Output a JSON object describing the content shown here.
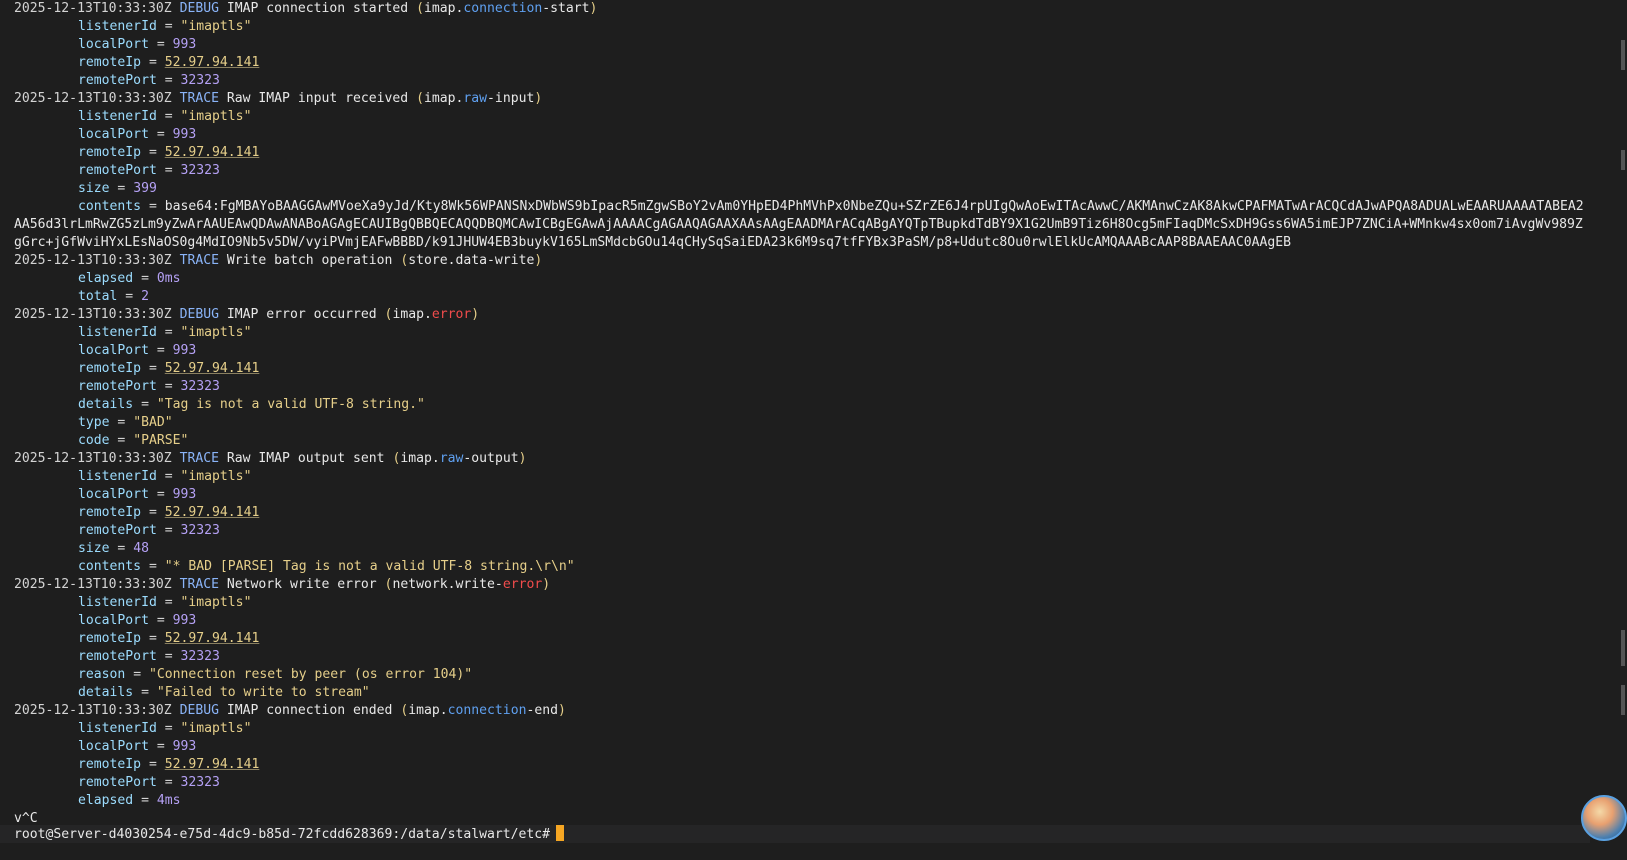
{
  "terminal": {
    "lines": [
      {
        "type": "header",
        "ts": "2025-12-13T10:33:30Z",
        "level": "DEBUG",
        "msg": "IMAP connection started",
        "event": [
          "imap.",
          "connection",
          "-start"
        ],
        "ev_error": false
      },
      {
        "type": "kv",
        "key": "listenerId",
        "val": "\"imaptls\"",
        "vtype": "str"
      },
      {
        "type": "kv",
        "key": "localPort",
        "val": "993",
        "vtype": "num"
      },
      {
        "type": "kv",
        "key": "remoteIp",
        "val": "52.97.94.141",
        "vtype": "ip"
      },
      {
        "type": "kv",
        "key": "remotePort",
        "val": "32323",
        "vtype": "num"
      },
      {
        "type": "header",
        "ts": "2025-12-13T10:33:30Z",
        "level": "TRACE",
        "msg": "Raw IMAP input received",
        "event": [
          "imap.",
          "raw",
          "-input"
        ],
        "ev_error": false
      },
      {
        "type": "kv",
        "key": "listenerId",
        "val": "\"imaptls\"",
        "vtype": "str"
      },
      {
        "type": "kv",
        "key": "localPort",
        "val": "993",
        "vtype": "num"
      },
      {
        "type": "kv",
        "key": "remoteIp",
        "val": "52.97.94.141",
        "vtype": "ip"
      },
      {
        "type": "kv",
        "key": "remotePort",
        "val": "32323",
        "vtype": "num"
      },
      {
        "type": "kv",
        "key": "size",
        "val": "399",
        "vtype": "num"
      },
      {
        "type": "kv",
        "key": "contents",
        "val": "base64:FgMBAYoBAAGGAwMVoeXa9yJd/Kty8Wk56WPANSNxDWbWS9bIpacR5mZgwSBoY2vAm0YHpED4PhMVhPx0NbeZQu+SZrZE6J4rpUIgQwAoEwITAcAwwC/AKMAnwCzAK8AkwCPAFMATwArACQCdAJwAPQA8ADUALwEAARUAAAATABEA2",
        "vtype": "b64"
      },
      {
        "type": "raw",
        "text": "AA56d3lrLmRwZG5zLm9yZwArAAUEAwQDAwANABoAGAgECAUIBgQBBQECAQQDBQMCAwICBgEGAwAjAAAACgAGAAQAGAAXAAsAAgEAADMArACqABgAYQTpTBupkdTdBY9X1G2UmB9Tiz6H8Ocg5mFIaqDMcSxDH9Gss6WA5imEJP7ZNCiA+WMnkw4sx0om7iAvgWv989Z"
      },
      {
        "type": "raw",
        "text": "gGrc+jGfWviHYxLEsNaOS0g4MdIO9Nb5v5DW/vyiPVmjEAFwBBBD/k91JHUW4EB3buykV165LmSMdcbGOu14qCHySqSaiEDA23k6M9sq7tfFYBx3PaSM/p8+Udutc8Ou0rwlElkUcAMQAAABcAAP8BAAEAAC0AAgEB"
      },
      {
        "type": "header",
        "ts": "2025-12-13T10:33:30Z",
        "level": "TRACE",
        "msg": "Write batch operation",
        "event": [
          "store.data-write",
          "",
          ""
        ],
        "ev_error": false
      },
      {
        "type": "kv",
        "key": "elapsed",
        "val": "0ms",
        "vtype": "num"
      },
      {
        "type": "kv",
        "key": "total",
        "val": "2",
        "vtype": "num"
      },
      {
        "type": "header",
        "ts": "2025-12-13T10:33:30Z",
        "level": "DEBUG",
        "msg": "IMAP error occurred",
        "event": [
          "imap.",
          "error",
          ""
        ],
        "ev_error": true
      },
      {
        "type": "kv",
        "key": "listenerId",
        "val": "\"imaptls\"",
        "vtype": "str"
      },
      {
        "type": "kv",
        "key": "localPort",
        "val": "993",
        "vtype": "num"
      },
      {
        "type": "kv",
        "key": "remoteIp",
        "val": "52.97.94.141",
        "vtype": "ip"
      },
      {
        "type": "kv",
        "key": "remotePort",
        "val": "32323",
        "vtype": "num"
      },
      {
        "type": "kv",
        "key": "details",
        "val": "\"Tag is not a valid UTF-8 string.\"",
        "vtype": "str"
      },
      {
        "type": "kv",
        "key": "type",
        "val": "\"BAD\"",
        "vtype": "str"
      },
      {
        "type": "kv",
        "key": "code",
        "val": "\"PARSE\"",
        "vtype": "str"
      },
      {
        "type": "header",
        "ts": "2025-12-13T10:33:30Z",
        "level": "TRACE",
        "msg": "Raw IMAP output sent",
        "event": [
          "imap.",
          "raw",
          "-output"
        ],
        "ev_error": false
      },
      {
        "type": "kv",
        "key": "listenerId",
        "val": "\"imaptls\"",
        "vtype": "str"
      },
      {
        "type": "kv",
        "key": "localPort",
        "val": "993",
        "vtype": "num"
      },
      {
        "type": "kv",
        "key": "remoteIp",
        "val": "52.97.94.141",
        "vtype": "ip"
      },
      {
        "type": "kv",
        "key": "remotePort",
        "val": "32323",
        "vtype": "num"
      },
      {
        "type": "kv",
        "key": "size",
        "val": "48",
        "vtype": "num"
      },
      {
        "type": "kv",
        "key": "contents",
        "val": "\"* BAD [PARSE] Tag is not a valid UTF-8 string.\\r\\n\"",
        "vtype": "str"
      },
      {
        "type": "header",
        "ts": "2025-12-13T10:33:30Z",
        "level": "TRACE",
        "msg": "Network write error",
        "event": [
          "network.write-",
          "error",
          ""
        ],
        "ev_error": true
      },
      {
        "type": "kv",
        "key": "listenerId",
        "val": "\"imaptls\"",
        "vtype": "str"
      },
      {
        "type": "kv",
        "key": "localPort",
        "val": "993",
        "vtype": "num"
      },
      {
        "type": "kv",
        "key": "remoteIp",
        "val": "52.97.94.141",
        "vtype": "ip"
      },
      {
        "type": "kv",
        "key": "remotePort",
        "val": "32323",
        "vtype": "num"
      },
      {
        "type": "kv",
        "key": "reason",
        "val": "\"Connection reset by peer (os error 104)\"",
        "vtype": "str"
      },
      {
        "type": "kv",
        "key": "details",
        "val": "\"Failed to write to stream\"",
        "vtype": "str"
      },
      {
        "type": "header",
        "ts": "2025-12-13T10:33:30Z",
        "level": "DEBUG",
        "msg": "IMAP connection ended",
        "event": [
          "imap.",
          "connection",
          "-end"
        ],
        "ev_error": false
      },
      {
        "type": "kv",
        "key": "listenerId",
        "val": "\"imaptls\"",
        "vtype": "str"
      },
      {
        "type": "kv",
        "key": "localPort",
        "val": "993",
        "vtype": "num"
      },
      {
        "type": "kv",
        "key": "remoteIp",
        "val": "52.97.94.141",
        "vtype": "ip"
      },
      {
        "type": "kv",
        "key": "remotePort",
        "val": "32323",
        "vtype": "num"
      },
      {
        "type": "kv",
        "key": "elapsed",
        "val": "4ms",
        "vtype": "num"
      },
      {
        "type": "raw",
        "text": "v^C"
      }
    ],
    "prompt": "root@Server-d4030254-e75d-4dc9-b85d-72fcdd628369:/data/stalwart/etc#"
  },
  "colors": {
    "background": "#1e1e1e",
    "cursor": "#f5a623",
    "key": "#9cdcfe",
    "number": "#b5a1f5",
    "string": "#e6cf8a",
    "error": "#f14c4c"
  },
  "icons": {
    "avatar": "user-avatar-icon"
  }
}
